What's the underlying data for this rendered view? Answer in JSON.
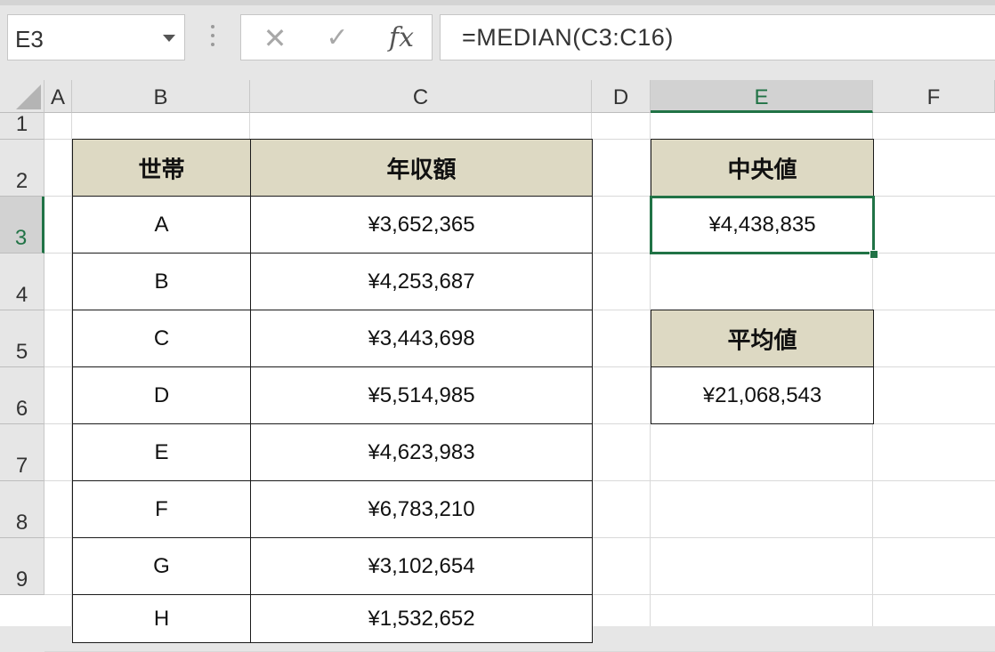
{
  "formula_bar": {
    "name_box": "E3",
    "cancel_glyph": "✕",
    "enter_glyph": "✓",
    "fx_label": "fx",
    "formula": "=MEDIAN(C3:C16)"
  },
  "columns": [
    "A",
    "B",
    "C",
    "D",
    "E",
    "F"
  ],
  "rows": [
    "1",
    "2",
    "3",
    "4",
    "5",
    "6",
    "7",
    "8",
    "9"
  ],
  "selected_cell": "E3",
  "colors": {
    "accent": "#217346",
    "header_fill": "#ddd9c3"
  },
  "table": {
    "headers": {
      "household": "世帯",
      "income": "年収額"
    },
    "rows": [
      {
        "household": "A",
        "income": "¥3,652,365"
      },
      {
        "household": "B",
        "income": "¥4,253,687"
      },
      {
        "household": "C",
        "income": "¥3,443,698"
      },
      {
        "household": "D",
        "income": "¥5,514,985"
      },
      {
        "household": "E",
        "income": "¥4,623,983"
      },
      {
        "household": "F",
        "income": "¥6,783,210"
      },
      {
        "household": "G",
        "income": "¥3,102,654"
      },
      {
        "household": "H",
        "income": "¥1,532,652"
      }
    ]
  },
  "summary": {
    "median_label": "中央値",
    "median_value": "¥4,438,835",
    "mean_label": "平均値",
    "mean_value": "¥21,068,543"
  }
}
